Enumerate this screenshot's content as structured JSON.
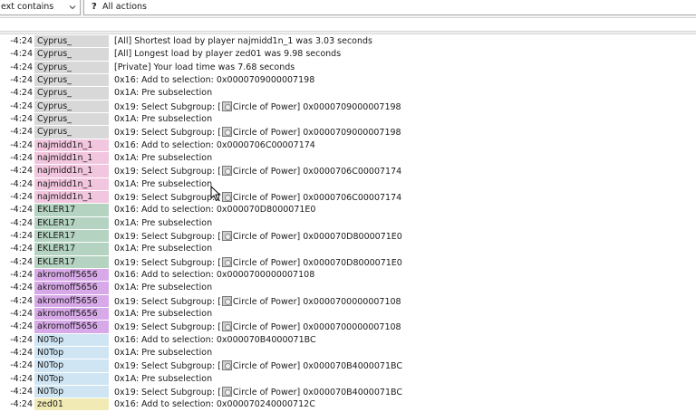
{
  "toolbar": {
    "filter_value": "ext contains",
    "actions_icon": "?",
    "actions_label": "All actions"
  },
  "colors": {
    "Cyprus_": "#d8d8d8",
    "najmidd1n_1": "#f2c6de",
    "EKLER17": "#b5d3c1",
    "akromoff5656": "#d8a9e8",
    "N0Top": "#cfe5f4",
    "zed01": "#f2eab4"
  },
  "rows": [
    {
      "time": "-4:24",
      "player": "Cyprus_",
      "pre": "[All] Shortest load by player najmidd1n_1 was 3.03 seconds",
      "icon": false,
      "post": ""
    },
    {
      "time": "-4:24",
      "player": "Cyprus_",
      "pre": "[All] Longest load by player zed01 was 9.98 seconds",
      "icon": false,
      "post": ""
    },
    {
      "time": "-4:24",
      "player": "Cyprus_",
      "pre": "[Private] Your load time was 7.68 seconds",
      "icon": false,
      "post": ""
    },
    {
      "time": "-4:24",
      "player": "Cyprus_",
      "pre": "0x16: Add to selection: 0x000070900000 7198",
      "icon": false,
      "post": ""
    },
    {
      "time": "-4:24",
      "player": "Cyprus_",
      "pre": "0x1A: Pre subselection",
      "icon": false,
      "post": ""
    },
    {
      "time": "-4:24",
      "player": "Cyprus_",
      "pre": "0x19: Select Subgroup: [",
      "icon": true,
      "post": "Circle of Power] 0x0000709000007198"
    },
    {
      "time": "-4:24",
      "player": "Cyprus_",
      "pre": "0x1A: Pre subselection",
      "icon": false,
      "post": ""
    },
    {
      "time": "-4:24",
      "player": "Cyprus_",
      "pre": "0x19: Select Subgroup: [",
      "icon": true,
      "post": "Circle of Power] 0x0000709000007198"
    },
    {
      "time": "-4:24",
      "player": "najmidd1n_1",
      "pre": "0x16: Add to selection: 0x0000706C00007174",
      "icon": false,
      "post": ""
    },
    {
      "time": "-4:24",
      "player": "najmidd1n_1",
      "pre": "0x1A: Pre subselection",
      "icon": false,
      "post": ""
    },
    {
      "time": "-4:24",
      "player": "najmidd1n_1",
      "pre": "0x19: Select Subgroup: [",
      "icon": true,
      "post": "Circle of Power] 0x0000706C00007174"
    },
    {
      "time": "-4:24",
      "player": "najmidd1n_1",
      "pre": "0x1A: Pre subselection",
      "icon": false,
      "post": ""
    },
    {
      "time": "-4:24",
      "player": "najmidd1n_1",
      "pre": "0x19: Select Subgroup: [",
      "icon": true,
      "post": "Circle of Power] 0x0000706C00007174"
    },
    {
      "time": "-4:24",
      "player": "EKLER17",
      "pre": "0x16: Add to selection: 0x000070D8000071E0",
      "icon": false,
      "post": ""
    },
    {
      "time": "-4:24",
      "player": "EKLER17",
      "pre": "0x1A: Pre subselection",
      "icon": false,
      "post": ""
    },
    {
      "time": "-4:24",
      "player": "EKLER17",
      "pre": "0x19: Select Subgroup: [",
      "icon": true,
      "post": "Circle of Power] 0x000070D8000071E0"
    },
    {
      "time": "-4:24",
      "player": "EKLER17",
      "pre": "0x1A: Pre subselection",
      "icon": false,
      "post": ""
    },
    {
      "time": "-4:24",
      "player": "EKLER17",
      "pre": "0x19: Select Subgroup: [",
      "icon": true,
      "post": "Circle of Power] 0x000070D8000071E0"
    },
    {
      "time": "-4:24",
      "player": "akromoff5656",
      "pre": "0x16: Add to selection: 0x0000700000007108",
      "icon": false,
      "post": ""
    },
    {
      "time": "-4:24",
      "player": "akromoff5656",
      "pre": "0x1A: Pre subselection",
      "icon": false,
      "post": ""
    },
    {
      "time": "-4:24",
      "player": "akromoff5656",
      "pre": "0x19: Select Subgroup: [",
      "icon": true,
      "post": "Circle of Power] 0x0000700000007108"
    },
    {
      "time": "-4:24",
      "player": "akromoff5656",
      "pre": "0x1A: Pre subselection",
      "icon": false,
      "post": ""
    },
    {
      "time": "-4:24",
      "player": "akromoff5656",
      "pre": "0x19: Select Subgroup: [",
      "icon": true,
      "post": "Circle of Power] 0x0000700000007108"
    },
    {
      "time": "-4:24",
      "player": "N0Top",
      "pre": "0x16: Add to selection: 0x000070B4000071BC",
      "icon": false,
      "post": ""
    },
    {
      "time": "-4:24",
      "player": "N0Top",
      "pre": "0x1A: Pre subselection",
      "icon": false,
      "post": ""
    },
    {
      "time": "-4:24",
      "player": "N0Top",
      "pre": "0x19: Select Subgroup: [",
      "icon": true,
      "post": "Circle of Power] 0x000070B4000071BC"
    },
    {
      "time": "-4:24",
      "player": "N0Top",
      "pre": "0x1A: Pre subselection",
      "icon": false,
      "post": ""
    },
    {
      "time": "-4:24",
      "player": "N0Top",
      "pre": "0x19: Select Subgroup: [",
      "icon": true,
      "post": "Circle of Power] 0x000070B4000071BC"
    },
    {
      "time": "-4:24",
      "player": "zed01",
      "pre": "0x16: Add to selection: 0x000070240000712C",
      "icon": false,
      "post": ""
    }
  ]
}
